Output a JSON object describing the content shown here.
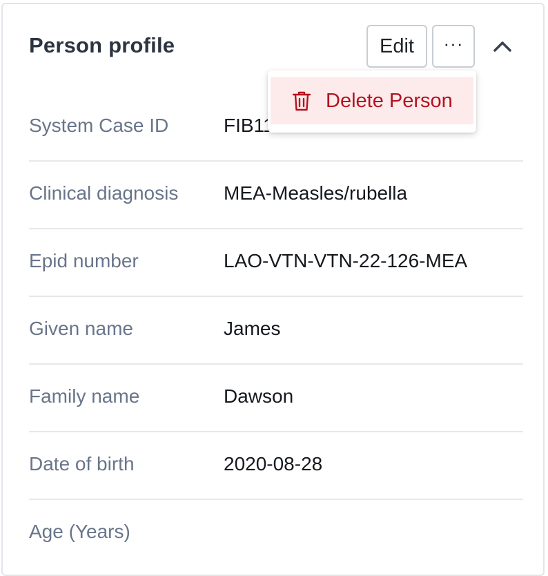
{
  "header": {
    "title": "Person profile",
    "edit_label": "Edit",
    "more_label": "···"
  },
  "menu": {
    "items": [
      {
        "label": "Delete Person",
        "icon": "trash-icon"
      }
    ]
  },
  "fields": [
    {
      "label": "System Case ID",
      "value": "FIB112000"
    },
    {
      "label": "Clinical diagnosis",
      "value": "MEA-Measles/rubella"
    },
    {
      "label": "Epid number",
      "value": "LAO-VTN-VTN-22-126-MEA"
    },
    {
      "label": "Given name",
      "value": "James"
    },
    {
      "label": "Family name",
      "value": "Dawson"
    },
    {
      "label": "Date of birth",
      "value": "2020-08-28"
    },
    {
      "label": "Age (Years)",
      "value": ""
    }
  ],
  "colors": {
    "danger": "#b3121f",
    "danger_bg": "#fdeaeb",
    "label": "#68758a",
    "title": "#2b3440"
  },
  "icons": {
    "collapse": "chevron-up-icon",
    "more": "ellipsis-icon",
    "delete": "trash-icon"
  }
}
